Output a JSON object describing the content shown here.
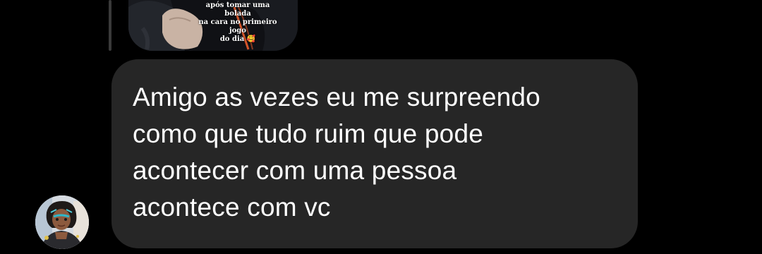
{
  "conversation": {
    "shared_post": {
      "caption": "após tomar uma bolada\nna cara no primeiro jogo\ndo dia 🥰"
    },
    "message": {
      "text": "Amigo as vezes eu me surpreendo\ncomo que tudo ruim que pode\nacontecer com uma pessoa\nacontece com vc"
    },
    "sender": {
      "avatar_icon": "user-avatar"
    }
  },
  "colors": {
    "background": "#000000",
    "bubble": "#262626",
    "text": "#ffffff",
    "reply_line": "#3a3a3a"
  }
}
